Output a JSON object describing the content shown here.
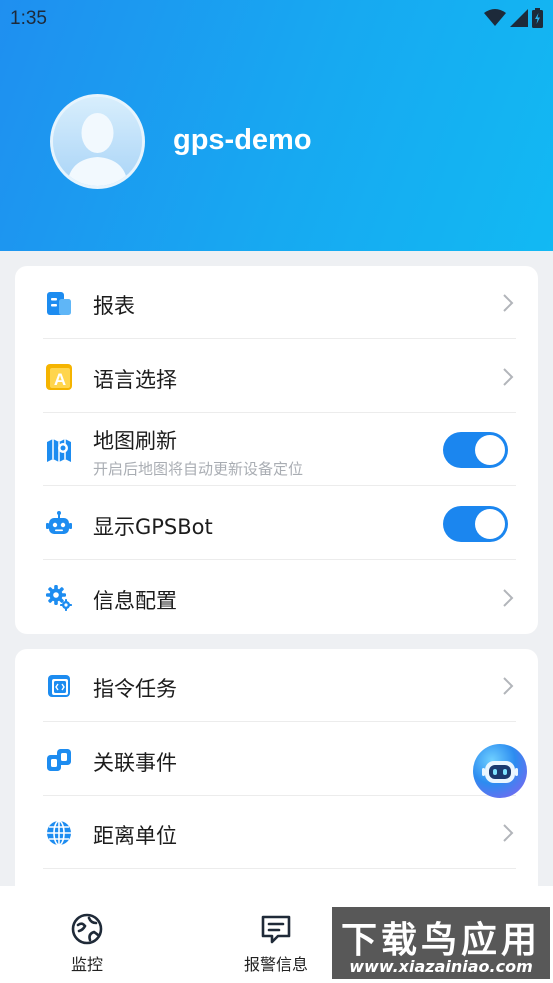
{
  "status_bar": {
    "time": "1:35",
    "icons": [
      "wifi-icon",
      "signal-icon",
      "battery-charging-icon"
    ]
  },
  "profile": {
    "username": "gps-demo",
    "avatar_icon": "avatar-placeholder-icon"
  },
  "colors": {
    "header_gradient_start": "#1f8ff0",
    "header_gradient_end": "#12b9f3",
    "accent": "#1b86ef",
    "background": "#eef0f3"
  },
  "settings_group_1": [
    {
      "label": "报表",
      "icon": "report-icon",
      "control": "chevron"
    },
    {
      "label": "语言选择",
      "icon": "language-icon",
      "control": "chevron"
    },
    {
      "label": "地图刷新",
      "sub": "开启后地图将自动更新设备定位",
      "icon": "map-refresh-icon",
      "control": "toggle",
      "on": true
    },
    {
      "label": "显示GPSBot",
      "icon": "robot-icon",
      "control": "toggle",
      "on": true
    },
    {
      "label": "信息配置",
      "icon": "settings-gears-icon",
      "control": "chevron"
    }
  ],
  "settings_group_2": [
    {
      "label": "指令任务",
      "icon": "command-icon",
      "control": "chevron"
    },
    {
      "label": "关联事件",
      "icon": "link-events-icon",
      "control": "chevron"
    },
    {
      "label": "距离单位",
      "icon": "globe-icon",
      "control": "chevron"
    }
  ],
  "floating_button": {
    "icon": "gpsbot-icon"
  },
  "bottom_nav": [
    {
      "label": "监控",
      "icon": "monitor-icon"
    },
    {
      "label": "报警信息",
      "icon": "alarm-message-icon"
    }
  ],
  "watermark": {
    "title": "下载鸟应用",
    "url": "www.xiazainiao.com"
  }
}
